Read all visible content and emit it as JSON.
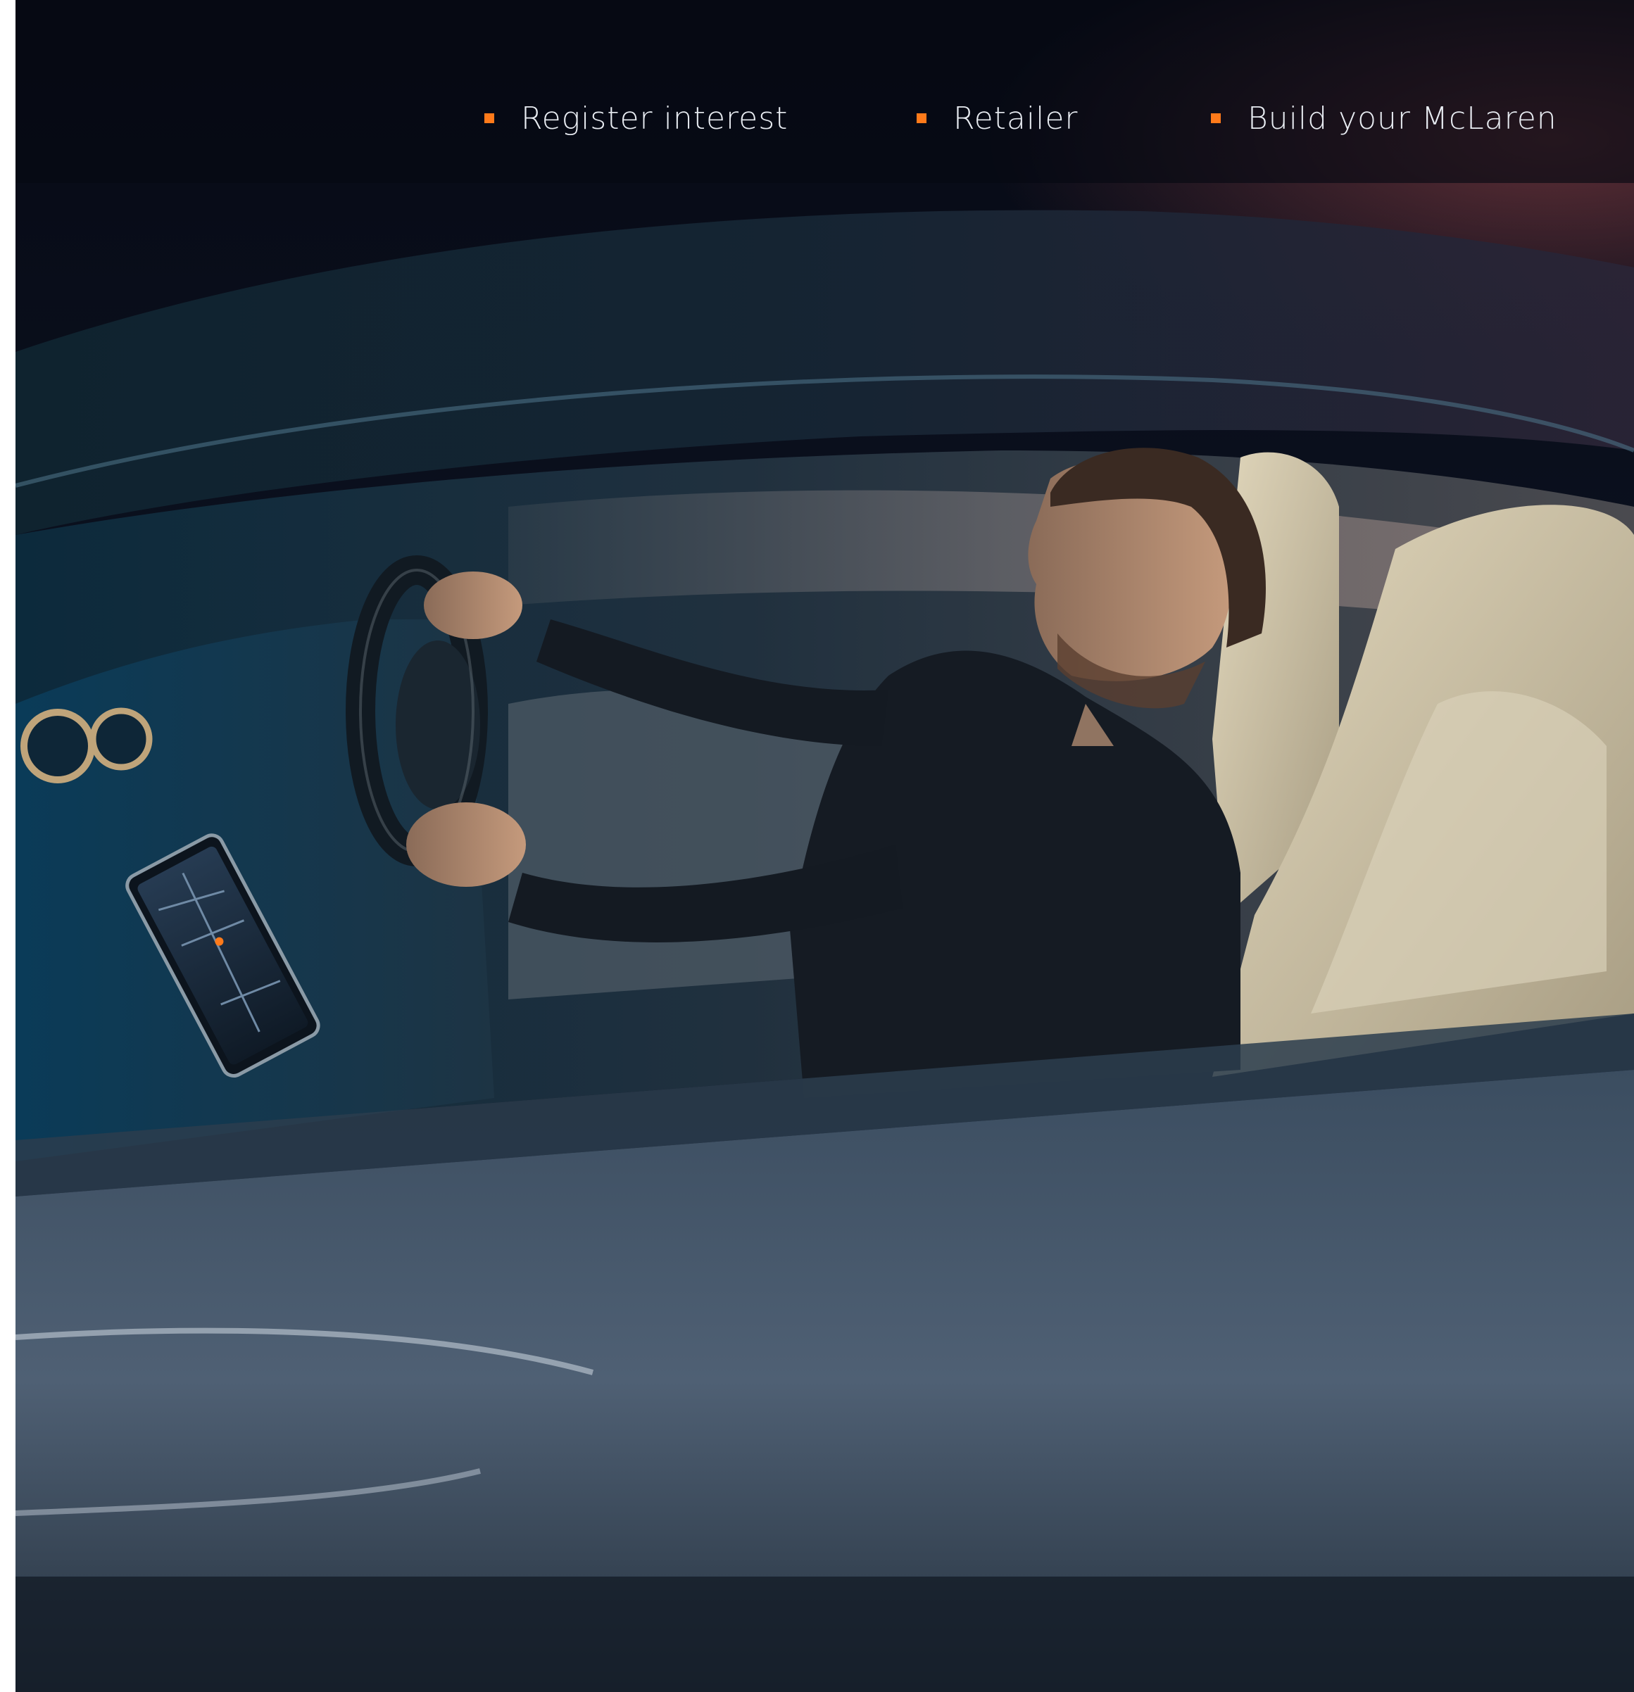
{
  "nav": {
    "accent_color": "#ff7a1a",
    "text_color": "#e8ecf2",
    "items": [
      {
        "label": "Register interest",
        "bullet": "orange-square"
      },
      {
        "label": "Retailer",
        "bullet": "orange-square"
      },
      {
        "label": "Build your McLaren",
        "bullet": "orange-square"
      }
    ]
  },
  "photo": {
    "subject": "driver-in-mclaren-car-at-night",
    "palette": {
      "sky": "#080c18",
      "cabin": "#1b2a3a",
      "dashboard": "#33485a",
      "seat": "#cfc3a5",
      "door_panel": "#3a4a5c"
    }
  }
}
